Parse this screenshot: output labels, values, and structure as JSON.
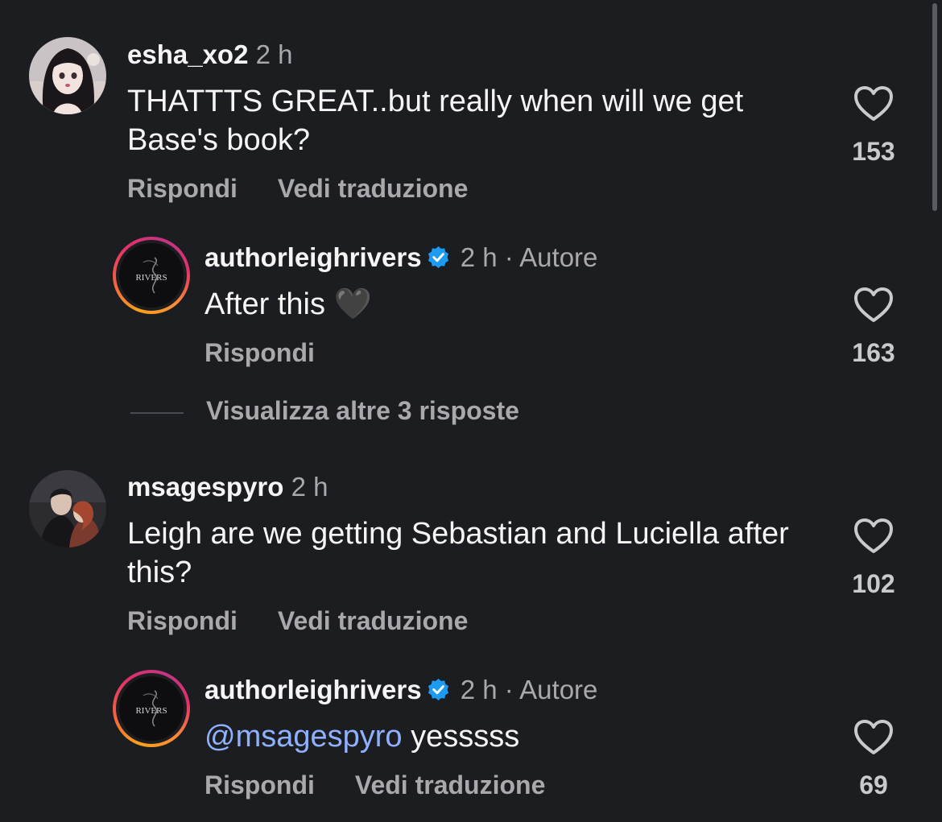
{
  "comments": [
    {
      "username": "esha_xo2",
      "time": "2 h",
      "text": "THATTTS GREAT..but really when will we get Base's book?",
      "reply_label": "Rispondi",
      "translate_label": "Vedi traduzione",
      "likes": "153",
      "avatar": "anime-girl-avatar"
    },
    {
      "username": "authorleighrivers",
      "time": "2 h",
      "separator": "·",
      "role": "Autore",
      "text": "After this 🖤",
      "reply_label": "Rispondi",
      "likes": "163",
      "avatar": "rivers-logo-avatar",
      "verified": true
    },
    {
      "username": "msagespyro",
      "time": "2 h",
      "text": "Leigh are we getting Sebastian and Luciella after this?",
      "reply_label": "Rispondi",
      "translate_label": "Vedi traduzione",
      "likes": "102",
      "avatar": "couple-illustration-avatar"
    },
    {
      "username": "authorleighrivers",
      "time": "2 h",
      "separator": "·",
      "role": "Autore",
      "mention": "@msagespyro",
      "text": "yesssss",
      "reply_label": "Rispondi",
      "translate_label": "Vedi traduzione",
      "likes": "69",
      "avatar": "rivers-logo-avatar",
      "verified": true
    }
  ],
  "view_more_replies": "Visualizza altre 3 risposte",
  "logo_text": "RIVERS",
  "colors": {
    "background": "#1c1d21",
    "secondary_text": "#a8a8ad",
    "mention": "#8fb0ff",
    "verified": "#1d9bf0"
  }
}
